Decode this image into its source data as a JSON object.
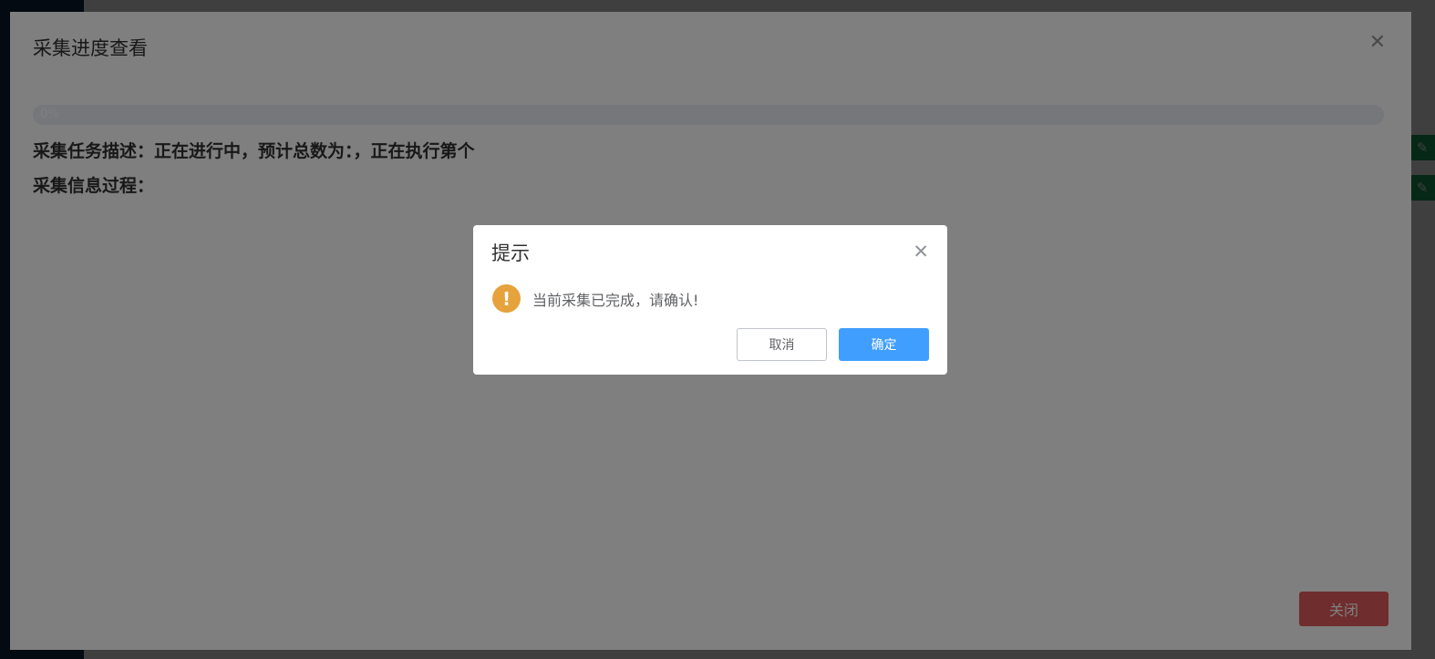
{
  "background_app": {
    "edit_icon": "pencil-icon"
  },
  "progress_dialog": {
    "title": "采集进度查看",
    "close_icon": "close-icon",
    "progress": {
      "value": 0,
      "text": "0%"
    },
    "task_desc": "采集任务描述：正在进行中，预计总数为：，正在执行第个",
    "process_label": "采集信息过程：",
    "close_button": "关闭"
  },
  "message_box": {
    "title": "提示",
    "close_icon": "close-icon",
    "icon": "warning-icon",
    "icon_glyph": "!",
    "message": "当前采集已完成，请确认!",
    "cancel_label": "取消",
    "confirm_label": "确定"
  },
  "colors": {
    "primary": "#409eff",
    "warning": "#e6a23c",
    "danger": "#e05b5b",
    "success": "#19a35b",
    "sidebar": "#0d2a47"
  }
}
